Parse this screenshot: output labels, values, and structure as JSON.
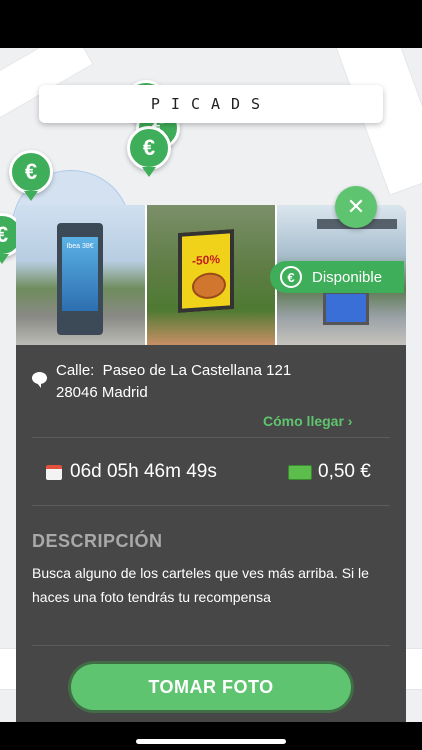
{
  "header": {
    "logo_text": "PICADS"
  },
  "map": {
    "pin_symbol": "€",
    "user_location": "blue-dot"
  },
  "card": {
    "photos": [
      "poster-kiosk-photo",
      "billboard-photo",
      "bus-shelter-photo"
    ],
    "photo_texts": {
      "kiosk": "Ibea 38€",
      "billboard": "-50%"
    },
    "badge": {
      "icon": "€",
      "label": "Disponible"
    },
    "close_icon": "✕",
    "address": {
      "line1": "Calle:  Paseo de La Castellana 121",
      "line2": "28046 Madrid"
    },
    "directions_label": "Cómo llegar  ›",
    "countdown": "06d 05h 46m 49s",
    "reward": "0,50 €",
    "description_title": "DESCRIPCIÓN",
    "description": "Busca alguno de los carteles que ves más arriba. Si le haces una foto tendrás tu recompensa"
  },
  "cta_label": "TOMAR FOTO",
  "colors": {
    "accent": "#5fc46f",
    "sheet": "#474747",
    "map": "#eef0f2"
  }
}
